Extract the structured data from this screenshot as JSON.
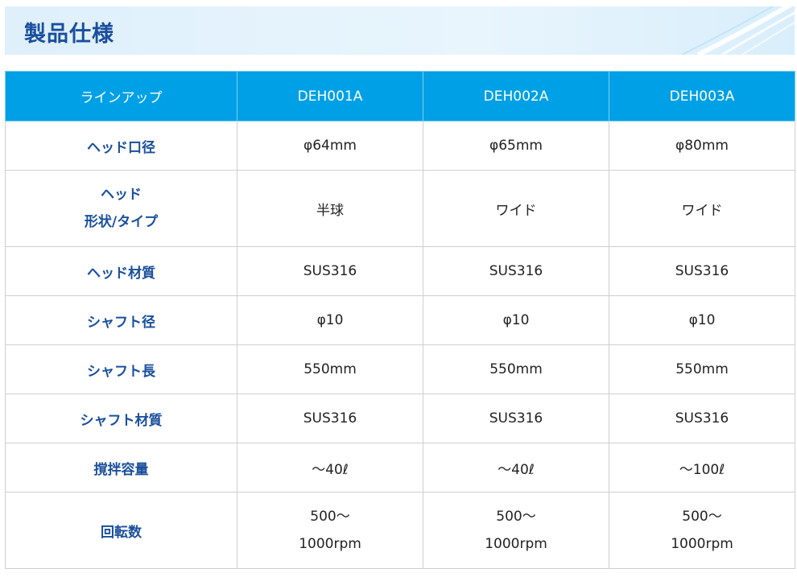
{
  "page": {
    "title": "製品仕様"
  },
  "table": {
    "header": [
      "ラインアップ",
      "DEH001A",
      "DEH002A",
      "DEH003A"
    ],
    "rows": [
      {
        "label": [
          "ヘッド口径"
        ],
        "values": [
          [
            "φ64mm"
          ],
          [
            "φ65mm"
          ],
          [
            "φ80mm"
          ]
        ]
      },
      {
        "label": [
          "ヘッド",
          "形状/タイプ"
        ],
        "values": [
          [
            "半球"
          ],
          [
            "ワイド"
          ],
          [
            "ワイド"
          ]
        ]
      },
      {
        "label": [
          "ヘッド材質"
        ],
        "values": [
          [
            "SUS316"
          ],
          [
            "SUS316"
          ],
          [
            "SUS316"
          ]
        ]
      },
      {
        "label": [
          "シャフト径"
        ],
        "values": [
          [
            "φ10"
          ],
          [
            "φ10"
          ],
          [
            "φ10"
          ]
        ]
      },
      {
        "label": [
          "シャフト長"
        ],
        "values": [
          [
            "550mm"
          ],
          [
            "550mm"
          ],
          [
            "550mm"
          ]
        ]
      },
      {
        "label": [
          "シャフト材質"
        ],
        "values": [
          [
            "SUS316"
          ],
          [
            "SUS316"
          ],
          [
            "SUS316"
          ]
        ]
      },
      {
        "label": [
          "撹拌容量"
        ],
        "values": [
          [
            "～40ℓ"
          ],
          [
            "～40ℓ"
          ],
          [
            "～100ℓ"
          ]
        ]
      },
      {
        "label": [
          "回転数"
        ],
        "values": [
          [
            "500～",
            "1000rpm"
          ],
          [
            "500～",
            "1000rpm"
          ],
          [
            "500～",
            "1000rpm"
          ]
        ]
      }
    ]
  },
  "colors": {
    "header_bg": "#00a0e6",
    "label_text": "#1a4f9c",
    "title_text": "#1a4f9c"
  }
}
